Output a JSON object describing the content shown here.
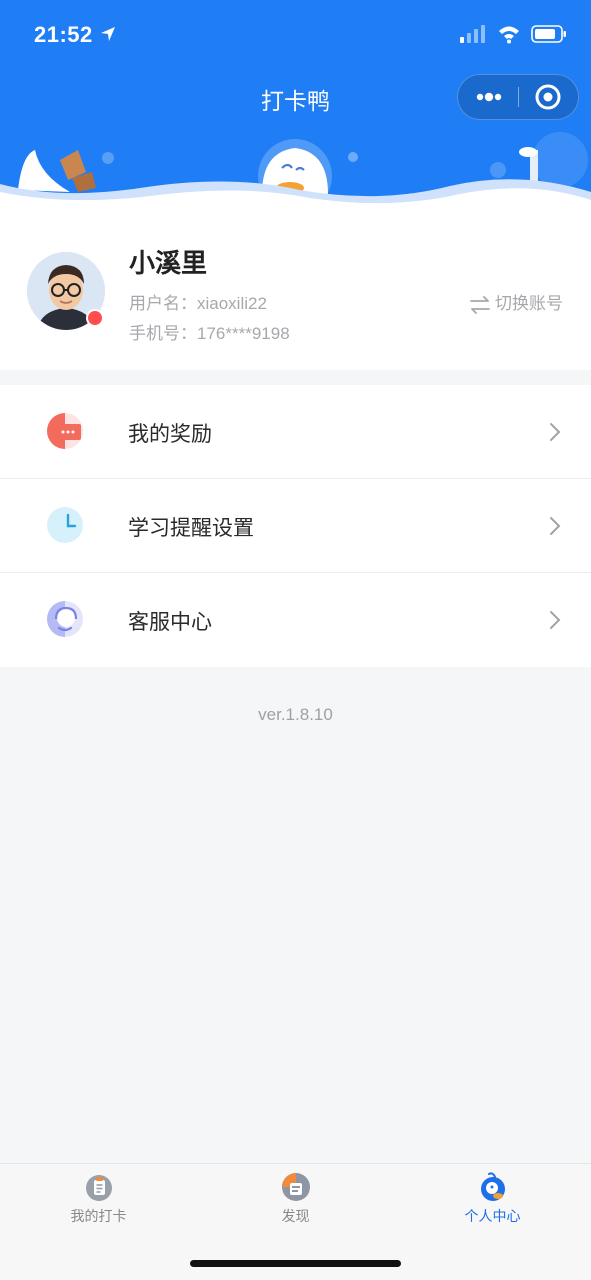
{
  "status_bar": {
    "time": "21:52"
  },
  "nav": {
    "title": "打卡鸭"
  },
  "profile": {
    "name": "小溪里",
    "username_label": "用户名：xiaoxili22",
    "phone_label": "手机号：176****9198",
    "switch_label": "切换账号"
  },
  "menu": {
    "items": [
      {
        "label": "我的奖励",
        "icon": "reward-icon"
      },
      {
        "label": "学习提醒设置",
        "icon": "reminder-clock-icon"
      },
      {
        "label": "客服中心",
        "icon": "customer-service-icon"
      }
    ]
  },
  "version": "ver.1.8.10",
  "tabs": [
    {
      "label": "我的打卡",
      "icon": "checkin-clipboard-icon",
      "active": false
    },
    {
      "label": "发现",
      "icon": "discover-icon",
      "active": false
    },
    {
      "label": "个人中心",
      "icon": "profile-icon",
      "active": true
    }
  ],
  "colors": {
    "brand_blue": "#1f7ef5",
    "active_tab": "#1f6fe8",
    "background": "#f5f6f8"
  }
}
